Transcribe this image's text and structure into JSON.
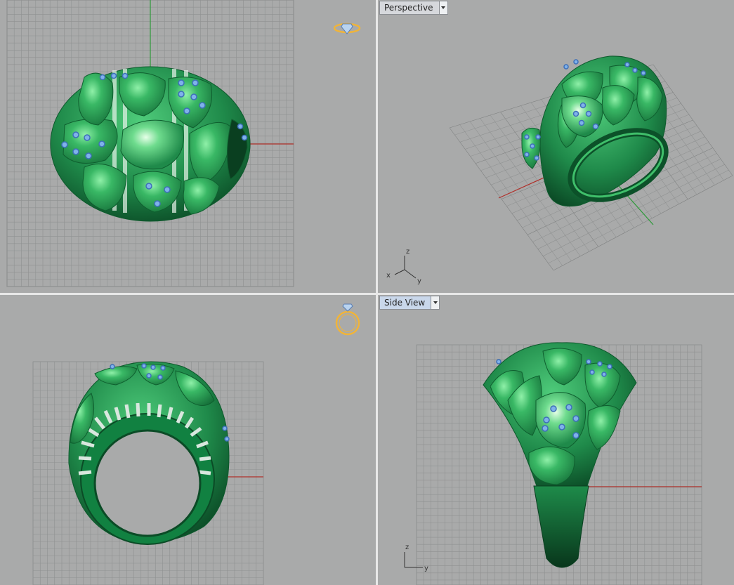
{
  "viewports": {
    "perspective_label": "Perspective",
    "side_label": "Side View"
  },
  "axis_labels": {
    "x": "x",
    "y": "y",
    "z": "z"
  },
  "colors": {
    "background": "#a9aaaa",
    "grid": "#8f9191",
    "x_axis": "#b0302a",
    "y_axis": "#2e9a3a",
    "model": "#1f8a4a",
    "gem": "#7fb2ea",
    "ring_icon": "#f0b43a"
  }
}
